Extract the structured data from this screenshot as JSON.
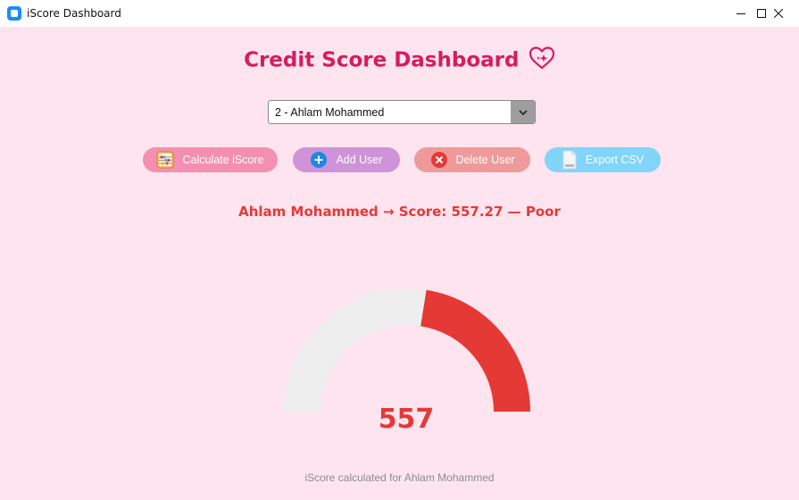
{
  "window": {
    "title": "iScore Dashboard"
  },
  "header": {
    "title": "Credit Score Dashboard",
    "icon": "heart-sparkle-icon"
  },
  "user_select": {
    "selected": "2 - Ahlam Mohammed"
  },
  "buttons": {
    "calculate": {
      "label": "Calculate iScore",
      "icon": "abacus-icon",
      "color": "#f48fb1"
    },
    "add": {
      "label": "Add User",
      "icon": "plus-circle-icon",
      "color": "#ce93d8"
    },
    "delete": {
      "label": "Delete User",
      "icon": "x-circle-icon",
      "color": "#ef9a9a"
    },
    "export": {
      "label": "Export CSV",
      "icon": "document-icon",
      "color": "#81d4fa"
    }
  },
  "result": {
    "text": "Ahlam Mohammed → Score: 557.27 — Poor",
    "color": "#e53935"
  },
  "gauge": {
    "display_value": "557",
    "fill_fraction": 0.45,
    "fill_color": "#e53935",
    "track_color": "#eeeeee"
  },
  "status": {
    "text": "iScore calculated for Ahlam Mohammed"
  }
}
